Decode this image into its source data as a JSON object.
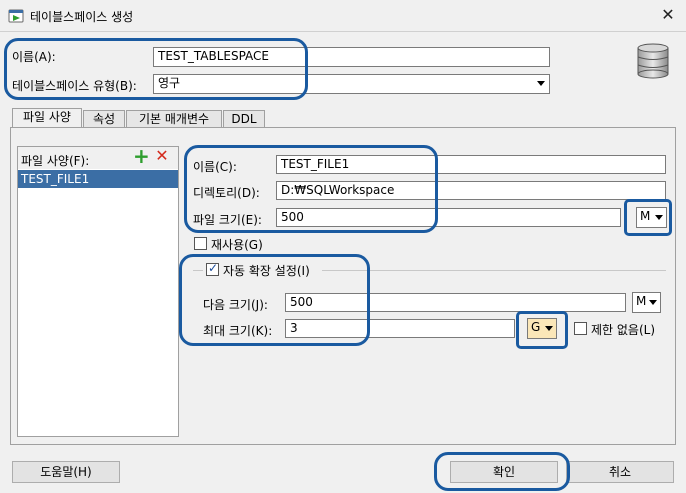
{
  "window": {
    "title": "테이블스페이스 생성",
    "close_glyph": "✕"
  },
  "top": {
    "name_label": "이름(A):",
    "name_value": "TEST_TABLESPACE",
    "type_label": "테이블스페이스 유형(B):",
    "type_value": "영구"
  },
  "tabs": [
    {
      "label": "파일 사양"
    },
    {
      "label": "속성"
    },
    {
      "label": "기본 매개변수"
    },
    {
      "label": "DDL"
    }
  ],
  "file_spec": {
    "list_label": "파일 사양(F):",
    "add_icon": "+",
    "remove_icon": "✕",
    "items": [
      "TEST_FILE1"
    ],
    "name_label": "이름(C):",
    "name_value": "TEST_FILE1",
    "dir_label": "디렉토리(D):",
    "dir_value": "D:₩SQLWorkspace",
    "size_label": "파일 크기(E):",
    "size_value": "500",
    "size_unit": "M",
    "reuse_label": "재사용(G)",
    "reuse_checked": false,
    "autoextend_label": "자동 확장 설정(I)",
    "autoextend_checked": true,
    "next_label": "다음 크기(J):",
    "next_value": "500",
    "next_unit": "M",
    "max_label": "최대 크기(K):",
    "max_value": "3",
    "max_unit": "G",
    "unlimited_label": "제한 없음(L)",
    "unlimited_checked": false
  },
  "footer": {
    "help_label": "도움말(H)",
    "ok_label": "확인",
    "cancel_label": "취소"
  },
  "colors": {
    "annotation": "#1a5aa0",
    "selection": "#3b6ea5",
    "add_icon": "#2e9e2e",
    "remove_icon": "#d42a1c"
  }
}
